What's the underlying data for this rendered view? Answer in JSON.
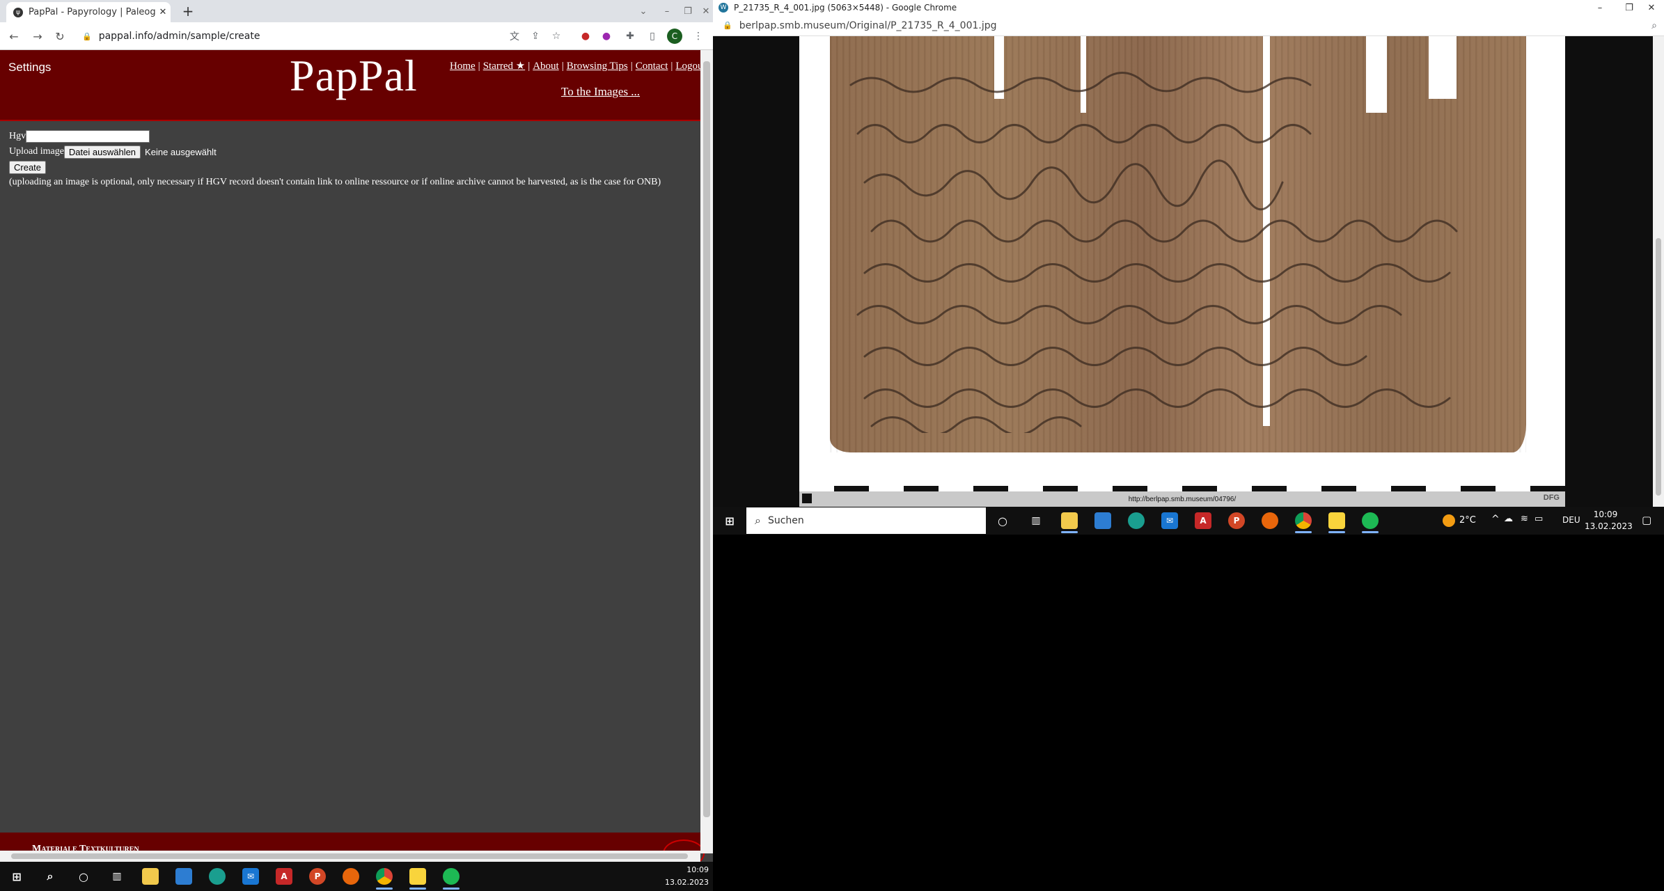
{
  "left_window": {
    "tab_title": "PapPal - Papyrology | Paleograph",
    "tab_favicon": "tab-favicon",
    "new_tab": "+",
    "url": "pappal.info/admin/sample/create",
    "profile_initial": "C",
    "site": {
      "settings": "Settings",
      "logo": "PapPal",
      "nav": [
        "Home",
        "Starred ★",
        "About",
        "Browsing Tips",
        "Contact",
        "Logout"
      ],
      "to_images": "To the Images ..."
    },
    "form": {
      "hgv_label": "Hgv",
      "hgv_value": "",
      "upload_label": "Upload image",
      "choose_file": "Datei auswählen",
      "no_file": "Keine ausgewählt",
      "create": "Create",
      "note": "(uploading an image is optional, only necessary if HGV record doesn't contain link to online ressource or if online archive cannot be harvested, as is the case for ONB)"
    },
    "footer_text": "Materiale Textkulturen",
    "clock": {
      "time": "10:09",
      "date": "13.02.2023"
    }
  },
  "right_window": {
    "title": "P_21735_R_4_001.jpg (5063×5448) - Google Chrome",
    "url": "berlpap.smb.museum/Original/P_21735_R_4_001.jpg",
    "image_caption": "http://berlpap.smb.museum/04796/",
    "image_brand": "DFG",
    "taskbar": {
      "search_placeholder": "Suchen",
      "temperature": "2°C",
      "language": "DEU",
      "time": "10:09",
      "date": "13.02.2023"
    }
  }
}
